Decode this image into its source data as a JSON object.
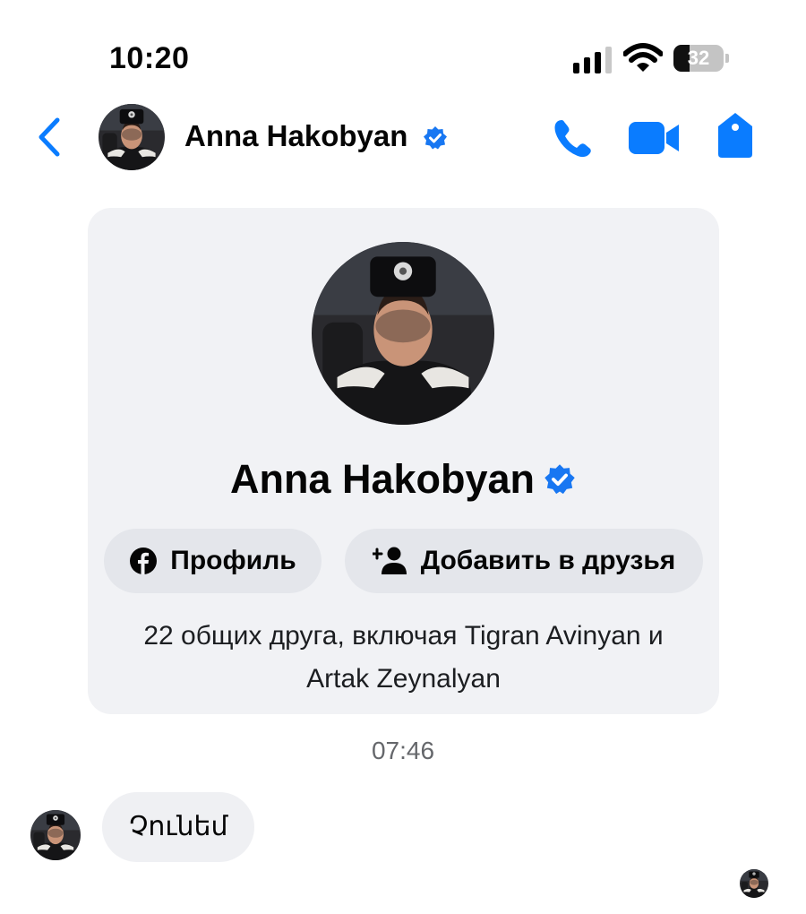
{
  "status_bar": {
    "time": "10:20",
    "battery": "32",
    "battery_level": 0.32
  },
  "header": {
    "contact_name": "Anna Hakobyan",
    "verified": true
  },
  "profile_card": {
    "name": "Anna Hakobyan",
    "profile_button": "Профиль",
    "add_friend_button": "Добавить в друзья",
    "mutual_line1": "22 общих друга, включая Tigran Avinyan и",
    "mutual_line2": "Artak Zeynalyan"
  },
  "conversation": {
    "timestamp": "07:46",
    "message": "Չունեմ"
  },
  "colors": {
    "accent": "#1877f2",
    "messenger_blue": "#0a7cff",
    "card_bg": "#f1f2f5",
    "button_bg": "#e4e6eb"
  },
  "icons": [
    "back-chevron-icon",
    "phone-icon",
    "video-camera-icon",
    "tag-icon",
    "verified-badge-icon",
    "facebook-icon",
    "add-friend-icon",
    "wifi-icon",
    "signal-icon",
    "battery-icon"
  ]
}
